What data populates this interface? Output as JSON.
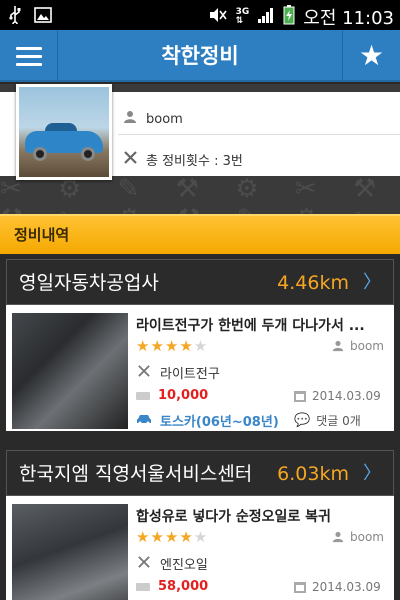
{
  "status_bar": {
    "left_icons": [
      "usb-icon",
      "image-icon"
    ],
    "right_icons": [
      "mute-icon",
      "3g-icon",
      "signal-icon",
      "battery-icon"
    ],
    "network": "3G",
    "time": "오전 11:03"
  },
  "app_bar": {
    "title": "착한정비",
    "menu_icon": "hamburger-menu-icon",
    "favorite_icon": "star-icon"
  },
  "profile": {
    "username": "boom",
    "maintenance_count": "총 정비횟수 : 3번"
  },
  "section": {
    "title": "정비내역"
  },
  "shops": [
    {
      "name": "영일자동차공업사",
      "distance": "4.46km",
      "review": {
        "title": "라이트전구가  한번에 두개  다나가서 ...",
        "rating": 4,
        "rating_max": 5,
        "author": "boom",
        "service": "라이트전구",
        "price": "10,000",
        "date": "2014.03.09",
        "car": "토스카(06년~08년)",
        "comments": "댓글 0개"
      }
    },
    {
      "name": "한국지엠 직영서울서비스센터",
      "distance": "6.03km",
      "review": {
        "title": "합성유로 넣다가 순정오일로 복귀",
        "rating": 4,
        "rating_max": 5,
        "author": "boom",
        "service": "엔진오일",
        "price": "58,000",
        "date": "2014.03.09"
      }
    }
  ],
  "colors": {
    "app_bar": "#2d7fc1",
    "section_header": "#f5a900",
    "distance": "#f5a623",
    "price": "#e32020",
    "car_model": "#3a86c8"
  }
}
